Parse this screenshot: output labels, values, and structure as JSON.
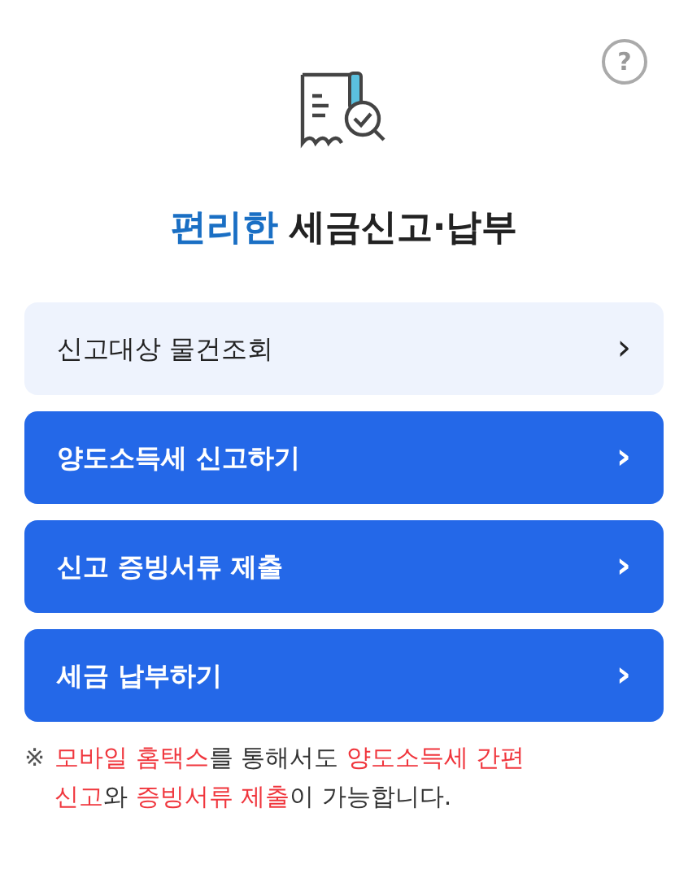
{
  "help": {
    "label": "?"
  },
  "title": {
    "accent": "편리한",
    "main": "세금신고·납부"
  },
  "menu": [
    {
      "label": "신고대상 물건조회",
      "kind": "light",
      "arrow": "›"
    },
    {
      "label": "양도소득세 신고하기",
      "kind": "primary",
      "arrow": "›"
    },
    {
      "label": "신고 증빙서류 제출",
      "kind": "primary",
      "arrow": "›"
    },
    {
      "label": "세금 납부하기",
      "kind": "primary",
      "arrow": "›"
    }
  ],
  "note": {
    "mark": "※",
    "segments": [
      {
        "text": "모바일 홈택스",
        "highlight": true
      },
      {
        "text": "를 통해서도 ",
        "highlight": false
      },
      {
        "text": "양도소득세 간편 신고",
        "highlight": true
      },
      {
        "text": "와 ",
        "highlight": false
      },
      {
        "text": "증빙서류 제출",
        "highlight": true
      },
      {
        "text": "이 가능합니다.",
        "highlight": false
      }
    ]
  }
}
